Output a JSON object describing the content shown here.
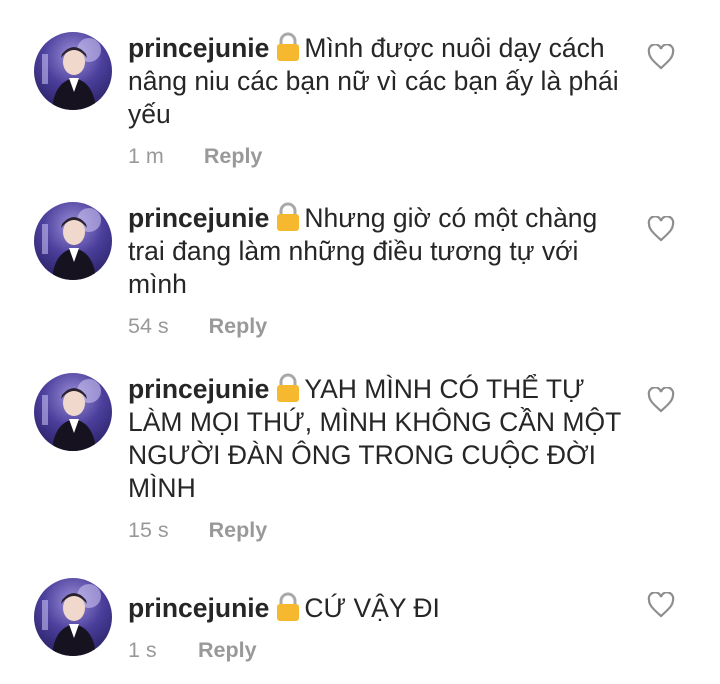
{
  "comments": [
    {
      "username": "princejunie",
      "lock_icon": "lock-icon",
      "text": "Mình được nuôi dạy cách nâng niu các bạn nữ vì các bạn ấy là phái yếu",
      "time": "1 m",
      "reply_label": "Reply",
      "like_icon": "heart-outline-icon"
    },
    {
      "username": "princejunie",
      "lock_icon": "lock-icon",
      "text": "Nhưng giờ có một chàng trai đang làm những điều tương tự với mình",
      "time": "54 s",
      "reply_label": "Reply",
      "like_icon": "heart-outline-icon"
    },
    {
      "username": "princejunie",
      "lock_icon": "lock-icon",
      "text": "YAH MÌNH CÓ THỂ TỰ LÀM MỌI THỨ, MÌNH KHÔNG CẦN MỘT NGƯỜI ĐÀN ÔNG TRONG CUỘC ĐỜI MÌNH",
      "time": "15 s",
      "reply_label": "Reply",
      "like_icon": "heart-outline-icon"
    },
    {
      "username": "princejunie",
      "lock_icon": "lock-icon",
      "text": "CỨ VẬY ĐI",
      "time": "1 s",
      "reply_label": "Reply",
      "like_icon": "heart-outline-icon"
    }
  ],
  "colors": {
    "text": "#262626",
    "meta": "#999999",
    "lock": "#f5b82e"
  }
}
